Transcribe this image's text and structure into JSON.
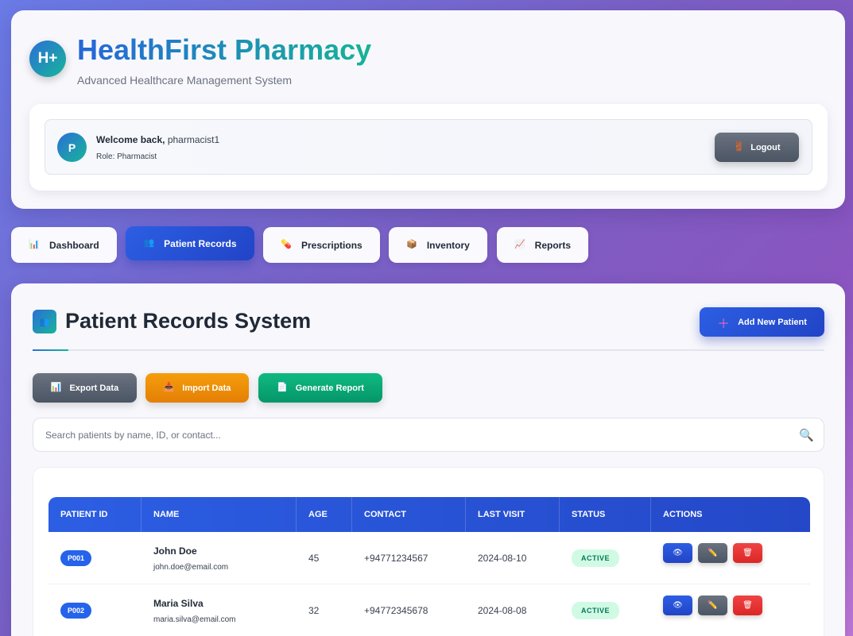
{
  "header": {
    "logo_text": "H+",
    "title": "HealthFirst Pharmacy",
    "subtitle": "Advanced Healthcare Management System"
  },
  "user": {
    "avatar_initial": "P",
    "welcome_prefix": "Welcome back,",
    "username": "pharmacist1",
    "role": "Role: Pharmacist",
    "logout_label": "Logout"
  },
  "tabs": [
    {
      "label": "Dashboard",
      "icon": "bar-chart-icon",
      "active": false
    },
    {
      "label": "Patient Records",
      "icon": "people-icon",
      "active": true
    },
    {
      "label": "Prescriptions",
      "icon": "pill-icon",
      "active": false
    },
    {
      "label": "Inventory",
      "icon": "package-icon",
      "active": false
    },
    {
      "label": "Reports",
      "icon": "trend-chart-icon",
      "active": false
    }
  ],
  "section": {
    "title": "Patient Records System",
    "add_label": "Add New Patient",
    "export_label": "Export Data",
    "import_label": "Import Data",
    "report_label": "Generate Report"
  },
  "search": {
    "placeholder": "Search patients by name, ID, or contact..."
  },
  "table": {
    "columns": [
      "PATIENT ID",
      "NAME",
      "AGE",
      "CONTACT",
      "LAST VISIT",
      "STATUS",
      "ACTIONS"
    ],
    "rows": [
      {
        "id": "P001",
        "name": "John Doe",
        "email": "john.doe@email.com",
        "age": "45",
        "contact": "+94771234567",
        "last_visit": "2024-08-10",
        "status": "ACTIVE"
      },
      {
        "id": "P002",
        "name": "Maria Silva",
        "email": "maria.silva@email.com",
        "age": "32",
        "contact": "+94772345678",
        "last_visit": "2024-08-08",
        "status": "ACTIVE"
      }
    ]
  },
  "colors": {
    "primary": "#2c5ee3",
    "accent_teal": "#17b59a",
    "export_btn": "#5b6472",
    "import_btn": "#f59e0b",
    "report_btn": "#10b981",
    "edit_btn": "#5b6472",
    "delete_btn": "#ef4444",
    "status_active_bg": "#d1fae5"
  }
}
